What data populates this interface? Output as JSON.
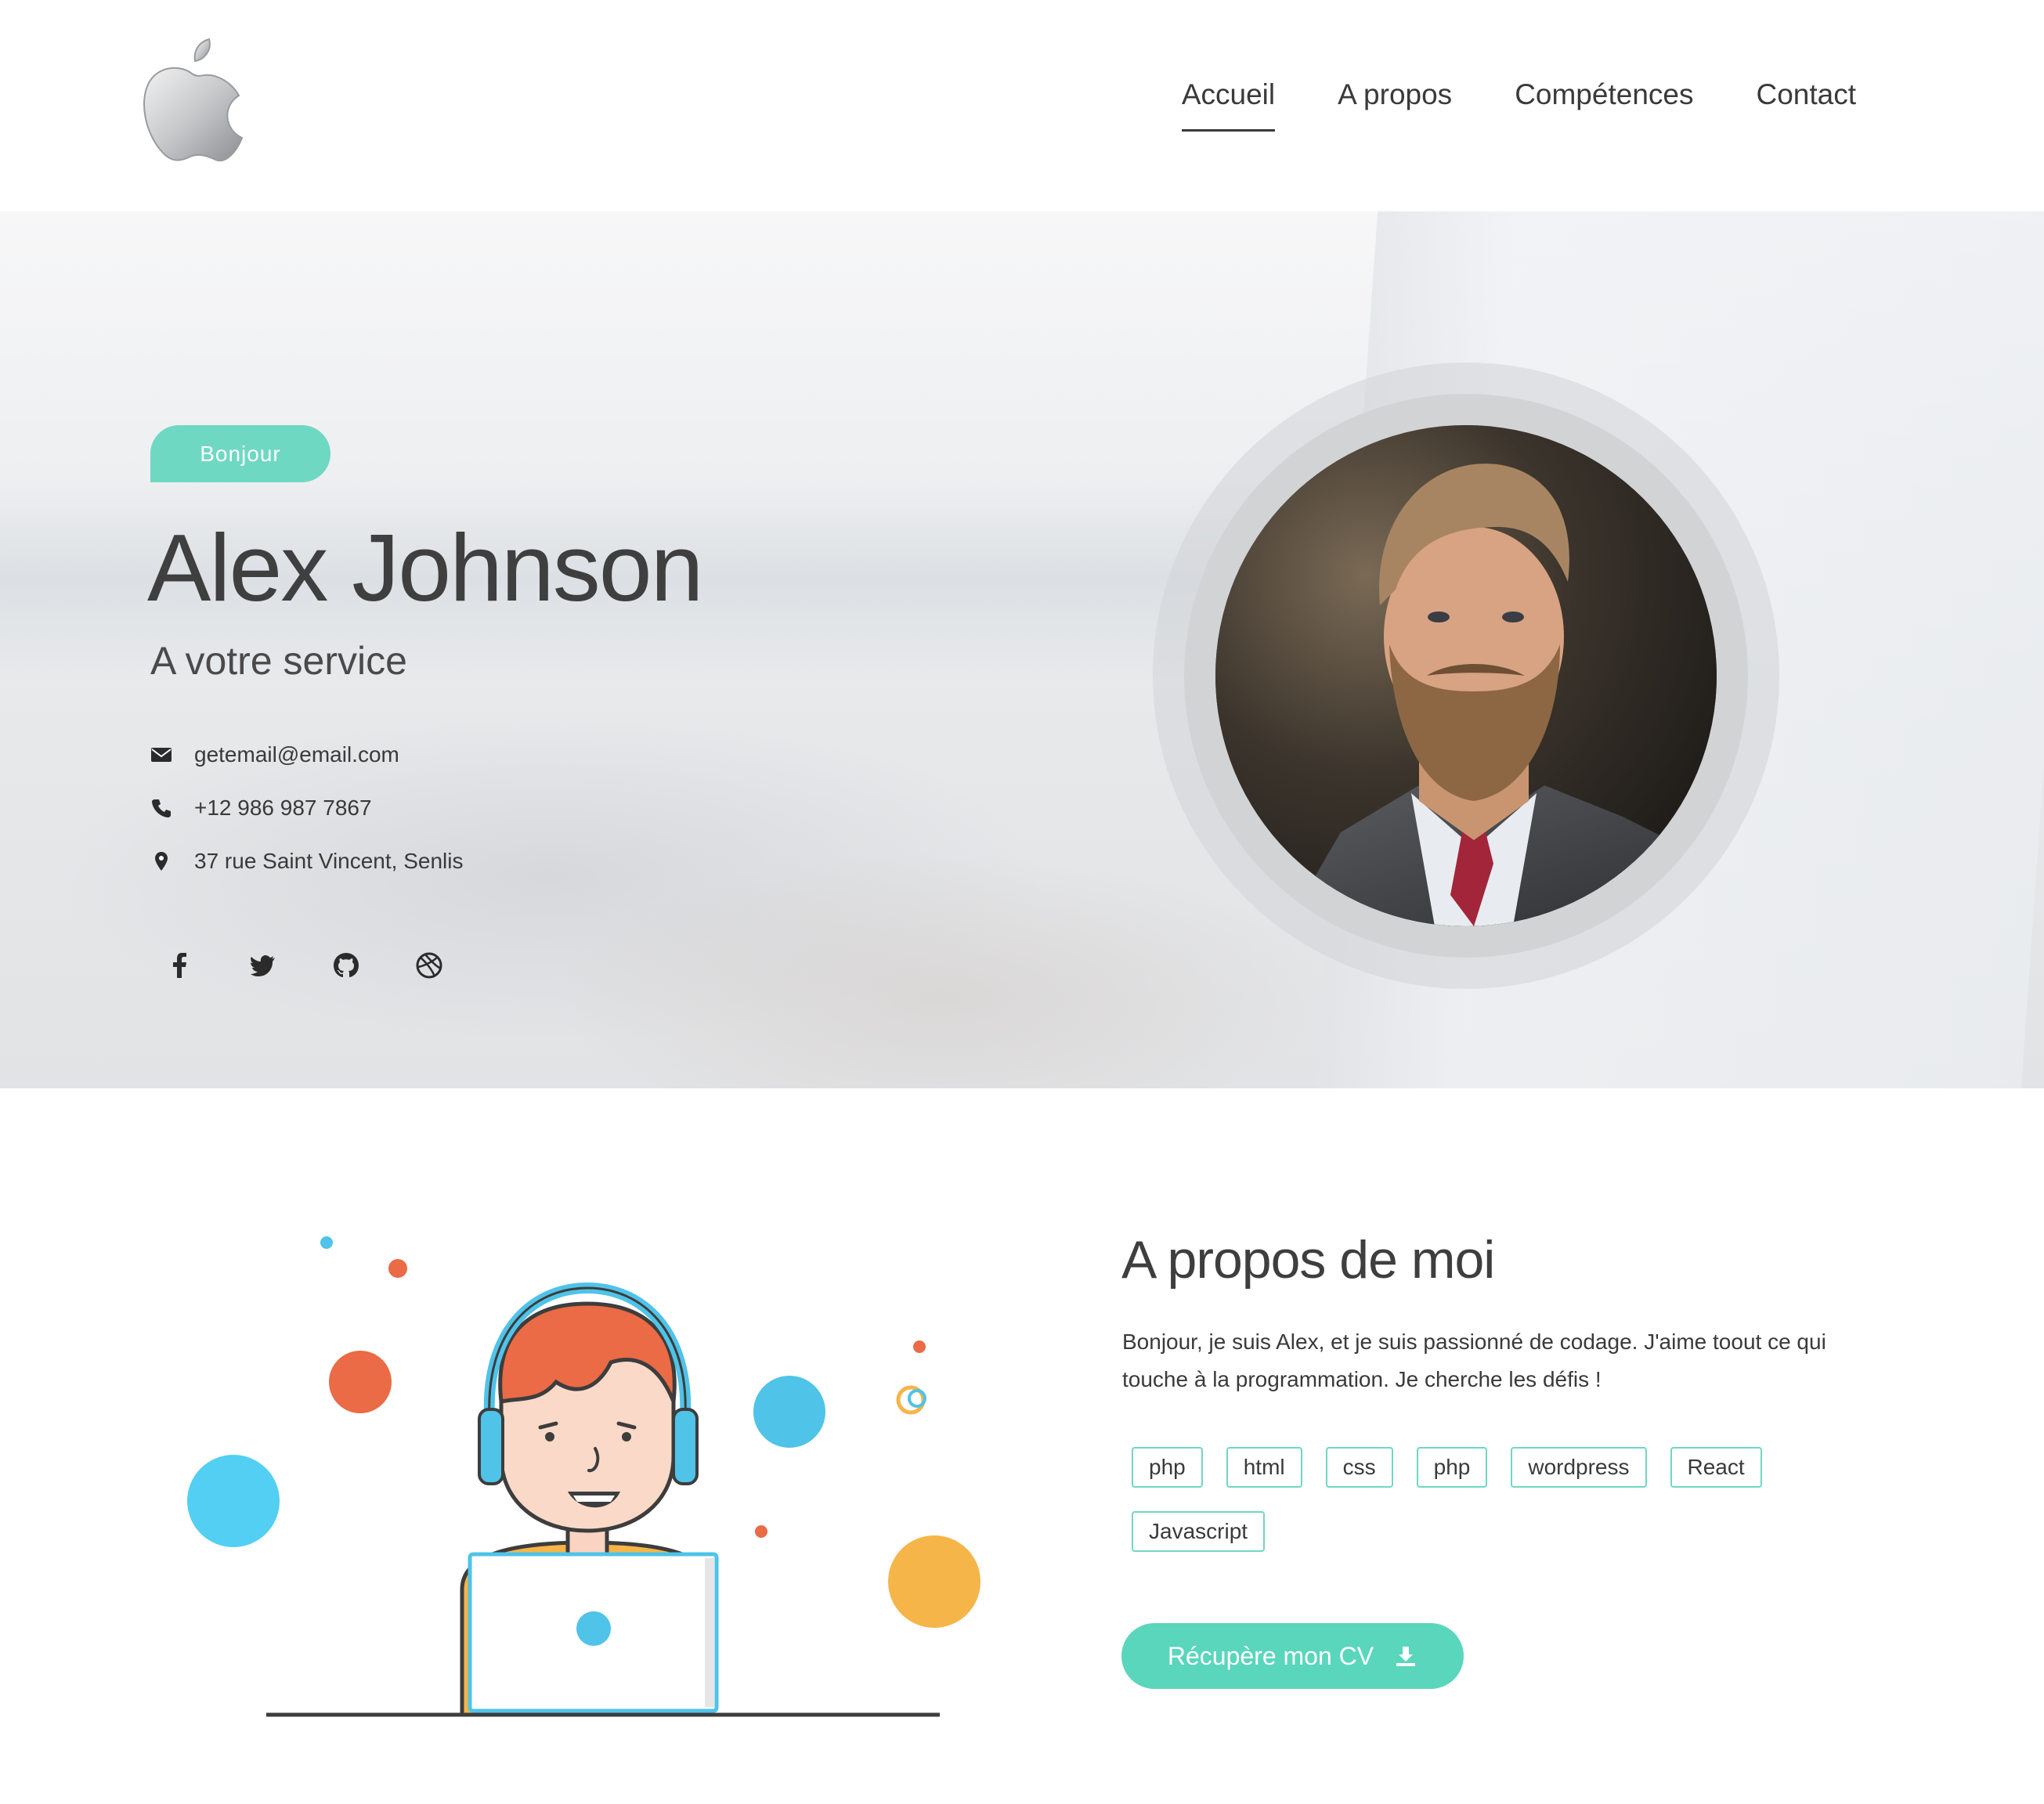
{
  "header": {
    "logo_icon": "apple-logo-icon",
    "nav": [
      {
        "label": "Accueil",
        "active": true
      },
      {
        "label": "A propos",
        "active": false
      },
      {
        "label": "Compétences",
        "active": false
      },
      {
        "label": "Contact",
        "active": false
      }
    ]
  },
  "hero": {
    "badge": "Bonjour",
    "name": "Alex Johnson",
    "subtitle": "A votre service",
    "contacts": [
      {
        "icon": "envelope-icon",
        "text": "getemail@email.com"
      },
      {
        "icon": "phone-icon",
        "text": "+12 986 987 7867"
      },
      {
        "icon": "map-marker-icon",
        "text": "37 rue Saint Vincent, Senlis"
      }
    ],
    "socials": [
      "facebook-icon",
      "twitter-icon",
      "github-icon",
      "dribbble-icon"
    ]
  },
  "about": {
    "title": "A propos de moi",
    "text": "Bonjour, je suis Alex, et je suis passionné de codage. J'aime toout ce qui touche à la programmation. Je cherche les défis !",
    "tags": [
      "php",
      "html",
      "css",
      "php",
      "wordpress",
      "React",
      "Javascript"
    ],
    "cv_button": "Récupère mon CV",
    "cv_icon": "download-icon"
  },
  "colors": {
    "accent": "#5ad6bd",
    "text": "#3d3d3d"
  }
}
